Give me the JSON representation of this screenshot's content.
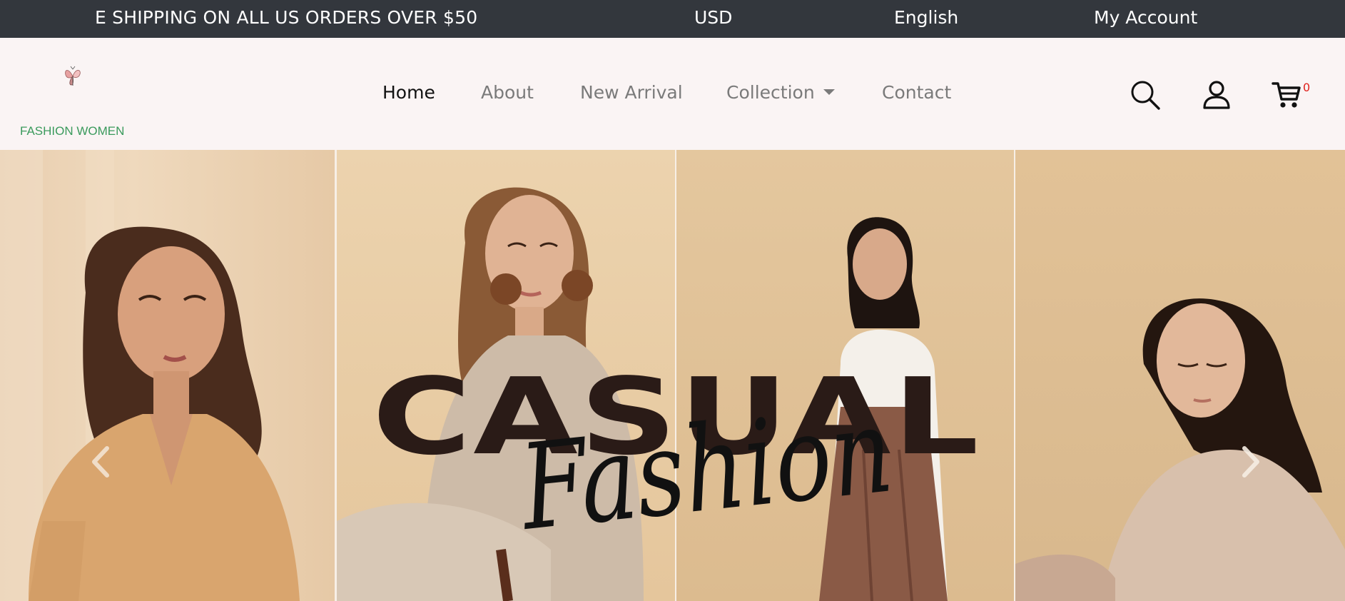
{
  "topbar": {
    "announcement": "E SHIPPING ON ALL US ORDERS OVER $50",
    "currency": "USD",
    "language": "English",
    "account": "My Account"
  },
  "brand": {
    "name": "FASHION WOMEN",
    "logo_icon": "butterfly-icon"
  },
  "nav": {
    "items": [
      {
        "label": "Home",
        "active": true
      },
      {
        "label": "About",
        "active": false
      },
      {
        "label": "New Arrival",
        "active": false
      },
      {
        "label": "Collection",
        "active": false,
        "dropdown": true
      },
      {
        "label": "Contact",
        "active": false
      }
    ]
  },
  "header_icons": {
    "search": "search-icon",
    "account": "user-icon",
    "cart": "cart-icon",
    "cart_count": "0"
  },
  "hero": {
    "headline": "CASUAL",
    "script_text": "Fashion",
    "prev_icon": "chevron-left-icon",
    "next_icon": "chevron-right-icon"
  },
  "colors": {
    "topbar_bg": "#33373d",
    "header_bg": "#faf4f4",
    "brand_green": "#3a9a5c",
    "cart_badge": "#e0201b",
    "headline_brown": "#2a1b17"
  }
}
